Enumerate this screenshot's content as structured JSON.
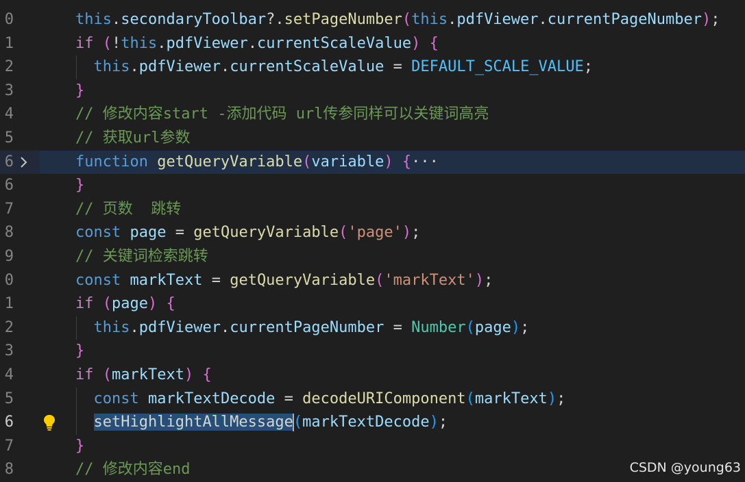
{
  "editor": {
    "line_numbers": [
      "0",
      "1",
      "2",
      "3",
      "4",
      "5",
      "6",
      "6",
      "7",
      "8",
      "9",
      "0",
      "1",
      "2",
      "3",
      "4",
      "5",
      "6",
      "7",
      "8"
    ],
    "lines": [
      {
        "tokens": [
          [
            "kw",
            "this"
          ],
          [
            "pun",
            "."
          ],
          [
            "var",
            "secondaryToolbar"
          ],
          [
            "pun",
            "?."
          ],
          [
            "fn",
            "setPageNumber"
          ],
          [
            "br2",
            "("
          ],
          [
            "kw",
            "this"
          ],
          [
            "pun",
            "."
          ],
          [
            "var",
            "pdfViewer"
          ],
          [
            "pun",
            "."
          ],
          [
            "var",
            "currentPageNumber"
          ],
          [
            "br2",
            ")"
          ],
          [
            "pun",
            ";"
          ]
        ]
      },
      {
        "tokens": [
          [
            "ctl",
            "if"
          ],
          [
            "pun",
            " "
          ],
          [
            "br2",
            "("
          ],
          [
            "pun",
            "!"
          ],
          [
            "kw",
            "this"
          ],
          [
            "pun",
            "."
          ],
          [
            "var",
            "pdfViewer"
          ],
          [
            "pun",
            "."
          ],
          [
            "var",
            "currentScaleValue"
          ],
          [
            "br2",
            ")"
          ],
          [
            "pun",
            " "
          ],
          [
            "br2",
            "{"
          ]
        ]
      },
      {
        "tokens": [
          [
            "pun",
            "  "
          ],
          [
            "kw",
            "this"
          ],
          [
            "pun",
            "."
          ],
          [
            "var",
            "pdfViewer"
          ],
          [
            "pun",
            "."
          ],
          [
            "var",
            "currentScaleValue"
          ],
          [
            "pun",
            " = "
          ],
          [
            "cst",
            "DEFAULT_SCALE_VALUE"
          ],
          [
            "pun",
            ";"
          ]
        ]
      },
      {
        "tokens": [
          [
            "br2",
            "}"
          ]
        ]
      },
      {
        "tokens": [
          [
            "cm",
            "// 修改内容start -添加代码 url传参同样可以关键词高亮"
          ]
        ]
      },
      {
        "tokens": [
          [
            "cm",
            "// 获取url参数"
          ]
        ]
      },
      {
        "tokens": [
          [
            "kw",
            "function"
          ],
          [
            "pun",
            " "
          ],
          [
            "fn",
            "getQueryVariable"
          ],
          [
            "br2",
            "("
          ],
          [
            "var",
            "variable"
          ],
          [
            "br2",
            ")"
          ],
          [
            "pun",
            " "
          ],
          [
            "br2",
            "{"
          ],
          [
            "pun",
            "···"
          ]
        ]
      },
      {
        "tokens": [
          [
            "br2",
            "}"
          ]
        ]
      },
      {
        "tokens": [
          [
            "cm",
            "// 页数  跳转"
          ]
        ]
      },
      {
        "tokens": [
          [
            "kw",
            "const"
          ],
          [
            "pun",
            " "
          ],
          [
            "var",
            "page"
          ],
          [
            "pun",
            " = "
          ],
          [
            "fn",
            "getQueryVariable"
          ],
          [
            "br2",
            "("
          ],
          [
            "str",
            "'page'"
          ],
          [
            "br2",
            ")"
          ],
          [
            "pun",
            ";"
          ]
        ]
      },
      {
        "tokens": [
          [
            "cm",
            "// 关键词检索跳转"
          ]
        ]
      },
      {
        "tokens": [
          [
            "kw",
            "const"
          ],
          [
            "pun",
            " "
          ],
          [
            "var",
            "markText"
          ],
          [
            "pun",
            " = "
          ],
          [
            "fn",
            "getQueryVariable"
          ],
          [
            "br2",
            "("
          ],
          [
            "str",
            "'markText'"
          ],
          [
            "br2",
            ")"
          ],
          [
            "pun",
            ";"
          ]
        ]
      },
      {
        "tokens": [
          [
            "ctl",
            "if"
          ],
          [
            "pun",
            " "
          ],
          [
            "br2",
            "("
          ],
          [
            "var",
            "page"
          ],
          [
            "br2",
            ")"
          ],
          [
            "pun",
            " "
          ],
          [
            "br2",
            "{"
          ]
        ]
      },
      {
        "tokens": [
          [
            "pun",
            "  "
          ],
          [
            "kw",
            "this"
          ],
          [
            "pun",
            "."
          ],
          [
            "var",
            "pdfViewer"
          ],
          [
            "pun",
            "."
          ],
          [
            "var",
            "currentPageNumber"
          ],
          [
            "pun",
            " = "
          ],
          [
            "typ",
            "Number"
          ],
          [
            "br3",
            "("
          ],
          [
            "var",
            "page"
          ],
          [
            "br3",
            ")"
          ],
          [
            "pun",
            ";"
          ]
        ]
      },
      {
        "tokens": [
          [
            "br2",
            "}"
          ]
        ]
      },
      {
        "tokens": [
          [
            "ctl",
            "if"
          ],
          [
            "pun",
            " "
          ],
          [
            "br2",
            "("
          ],
          [
            "var",
            "markText"
          ],
          [
            "br2",
            ")"
          ],
          [
            "pun",
            " "
          ],
          [
            "br2",
            "{"
          ]
        ]
      },
      {
        "tokens": [
          [
            "pun",
            "  "
          ],
          [
            "kw",
            "const"
          ],
          [
            "pun",
            " "
          ],
          [
            "var",
            "markTextDecode"
          ],
          [
            "pun",
            " = "
          ],
          [
            "fn",
            "decodeURIComponent"
          ],
          [
            "br3",
            "("
          ],
          [
            "var",
            "markText"
          ],
          [
            "br3",
            ")"
          ],
          [
            "pun",
            ";"
          ]
        ]
      },
      {
        "tokens": [
          [
            "pun",
            "  "
          ],
          [
            "sel",
            "setHighlightAllMessage"
          ],
          [
            "caret",
            ""
          ],
          [
            "br3",
            "("
          ],
          [
            "var",
            "markTextDecode"
          ],
          [
            "br3",
            ")"
          ],
          [
            "pun",
            ";"
          ]
        ]
      },
      {
        "tokens": [
          [
            "br2",
            "}"
          ]
        ]
      },
      {
        "tokens": [
          [
            "cm",
            "// 修改内容end"
          ]
        ]
      }
    ]
  },
  "watermark": "CSDN @young63"
}
